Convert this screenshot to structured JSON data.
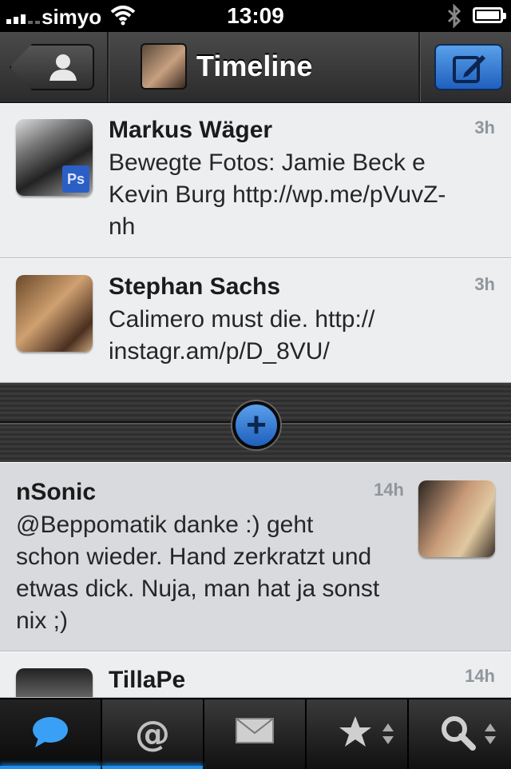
{
  "status_bar": {
    "carrier": "simyo",
    "time": "13:09"
  },
  "nav": {
    "title": "Timeline",
    "back_icon": "people-icon",
    "compose_icon": "compose-icon",
    "accent": "#2f7bd8"
  },
  "tweets": [
    {
      "name": "Markus Wäger",
      "time": "3h",
      "text_lines": [
        "Bewegte Fotos: Jamie Beck e",
        "Kevin Burg http://wp.me/pVuvZ-",
        "nh"
      ],
      "badge": "Ps"
    },
    {
      "name": "Stephan Sachs",
      "time": "3h",
      "text_lines": [
        "Calimero must die. http://",
        "instagr.am/p/D_8VU/"
      ]
    },
    {
      "name": "nSonic",
      "time": "14h",
      "text_lines": [
        "@Beppomatik danke :) geht",
        "schon wieder. Hand zerkratzt und",
        "etwas dick. Nuja, man hat ja sonst",
        "nix ;)"
      ]
    },
    {
      "name": "TillaPe",
      "time": "14h",
      "text_lines": []
    }
  ],
  "load_more": {
    "label": "+"
  },
  "tabs": [
    {
      "name": "timeline",
      "icon": "speech-bubble-icon",
      "active": true
    },
    {
      "name": "mentions",
      "icon": "at-sign-icon",
      "active": false
    },
    {
      "name": "messages",
      "icon": "envelope-icon",
      "active": false
    },
    {
      "name": "favorites",
      "icon": "star-icon",
      "active": false
    },
    {
      "name": "search",
      "icon": "magnifier-icon",
      "active": false
    }
  ]
}
